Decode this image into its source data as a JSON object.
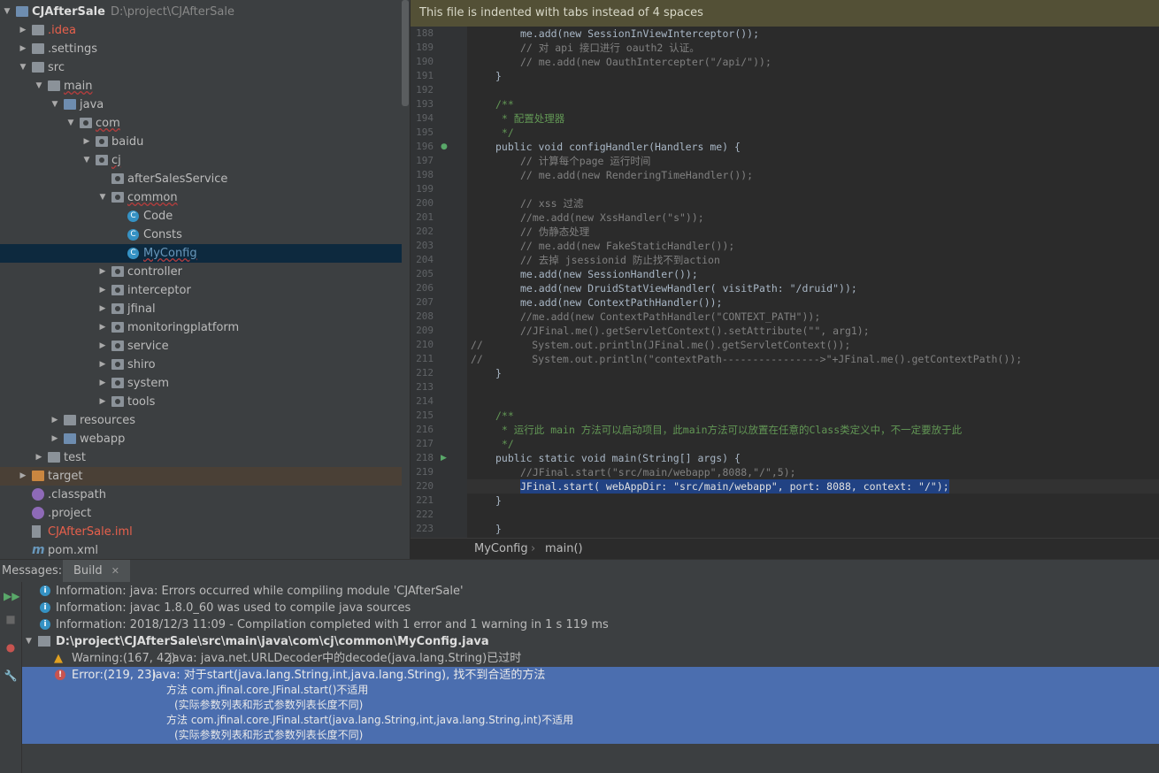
{
  "project": {
    "name": "CJAfterSale",
    "path": "D:\\project\\CJAfterSale",
    "tree": [
      {
        "label": "CJAfterSale",
        "indent": 0,
        "arrow": "open",
        "icon": "project-icon"
      },
      {
        "label": ".idea",
        "indent": 1,
        "arrow": "closed",
        "icon": "folder-icon",
        "style": "red"
      },
      {
        "label": ".settings",
        "indent": 1,
        "arrow": "closed",
        "icon": "folder-icon"
      },
      {
        "label": "src",
        "indent": 1,
        "arrow": "open",
        "icon": "folder-icon"
      },
      {
        "label": "main",
        "indent": 2,
        "arrow": "open",
        "icon": "folder-icon",
        "style": "wavy"
      },
      {
        "label": "java",
        "indent": 3,
        "arrow": "open",
        "icon": "source-folder-icon"
      },
      {
        "label": "com",
        "indent": 4,
        "arrow": "open",
        "icon": "package-icon",
        "style": "wavy"
      },
      {
        "label": "baidu",
        "indent": 5,
        "arrow": "closed",
        "icon": "package-icon"
      },
      {
        "label": "cj",
        "indent": 5,
        "arrow": "open",
        "icon": "package-icon",
        "style": "wavy"
      },
      {
        "label": "afterSalesService",
        "indent": 6,
        "arrow": "none",
        "icon": "package-icon"
      },
      {
        "label": "common",
        "indent": 6,
        "arrow": "open",
        "icon": "package-icon",
        "style": "wavy"
      },
      {
        "label": "Code",
        "indent": 7,
        "arrow": "none",
        "icon": "class-icon"
      },
      {
        "label": "Consts",
        "indent": 7,
        "arrow": "none",
        "icon": "class-icon"
      },
      {
        "label": "MyConfig",
        "indent": 7,
        "arrow": "none",
        "icon": "class-icon",
        "style": "blue-wavy",
        "selected": true
      },
      {
        "label": "controller",
        "indent": 6,
        "arrow": "closed",
        "icon": "package-icon"
      },
      {
        "label": "interceptor",
        "indent": 6,
        "arrow": "closed",
        "icon": "package-icon"
      },
      {
        "label": "jfinal",
        "indent": 6,
        "arrow": "closed",
        "icon": "package-icon"
      },
      {
        "label": "monitoringplatform",
        "indent": 6,
        "arrow": "closed",
        "icon": "package-icon"
      },
      {
        "label": "service",
        "indent": 6,
        "arrow": "closed",
        "icon": "package-icon"
      },
      {
        "label": "shiro",
        "indent": 6,
        "arrow": "closed",
        "icon": "package-icon"
      },
      {
        "label": "system",
        "indent": 6,
        "arrow": "closed",
        "icon": "package-icon"
      },
      {
        "label": "tools",
        "indent": 6,
        "arrow": "closed",
        "icon": "package-icon"
      },
      {
        "label": "resources",
        "indent": 3,
        "arrow": "closed",
        "icon": "resources-folder-icon"
      },
      {
        "label": "webapp",
        "indent": 3,
        "arrow": "closed",
        "icon": "web-folder-icon"
      },
      {
        "label": "test",
        "indent": 2,
        "arrow": "closed",
        "icon": "folder-icon"
      },
      {
        "label": "target",
        "indent": 1,
        "arrow": "closed",
        "icon": "excluded-folder-icon",
        "highlight": true
      },
      {
        "label": ".classpath",
        "indent": 1,
        "arrow": "none",
        "icon": "file-icon"
      },
      {
        "label": ".project",
        "indent": 1,
        "arrow": "none",
        "icon": "file-icon"
      },
      {
        "label": "CJAfterSale.iml",
        "indent": 1,
        "arrow": "none",
        "icon": "iml-file-icon",
        "style": "red"
      },
      {
        "label": "pom.xml",
        "indent": 1,
        "arrow": "none",
        "icon": "maven-icon"
      }
    ]
  },
  "editor": {
    "banner": "This file is indented with tabs instead of 4 spaces",
    "lines": [
      {
        "n": "188",
        "t": "\tme.add(new SessionInViewInterceptor());",
        "k": "code"
      },
      {
        "n": "189",
        "t": "\t// 对 api 接口进行 oauth2 认证。",
        "k": "cmt"
      },
      {
        "n": "190",
        "t": "\t// me.add(new OauthIntercepter(\"/api/\"));",
        "k": "cmt"
      },
      {
        "n": "191",
        "t": "}",
        "k": "code"
      },
      {
        "n": "192",
        "t": "",
        "k": "code"
      },
      {
        "n": "193",
        "t": "/**",
        "k": "doc"
      },
      {
        "n": "194",
        "t": " * 配置处理器",
        "k": "doc"
      },
      {
        "n": "195",
        "t": " */",
        "k": "doc"
      },
      {
        "n": "196",
        "t": "public void configHandler(Handlers me) {",
        "k": "code"
      },
      {
        "n": "197",
        "t": "\t// 计算每个page 运行时间",
        "k": "cmt"
      },
      {
        "n": "198",
        "t": "\t// me.add(new RenderingTimeHandler());",
        "k": "cmt"
      },
      {
        "n": "199",
        "t": "",
        "k": "code"
      },
      {
        "n": "200",
        "t": "\t// xss 过滤",
        "k": "cmt"
      },
      {
        "n": "201",
        "t": "\t//me.add(new XssHandler(\"s\"));",
        "k": "cmt"
      },
      {
        "n": "202",
        "t": "\t// 伪静态处理",
        "k": "cmt"
      },
      {
        "n": "203",
        "t": "\t// me.add(new FakeStaticHandler());",
        "k": "cmt"
      },
      {
        "n": "204",
        "t": "\t// 去掉 jsessionid 防止找不到action",
        "k": "cmt"
      },
      {
        "n": "205",
        "t": "\tme.add(new SessionHandler());",
        "k": "code"
      },
      {
        "n": "206",
        "t": "\tme.add(new DruidStatViewHandler( visitPath: \"/druid\"));",
        "k": "code"
      },
      {
        "n": "207",
        "t": "\tme.add(new ContextPathHandler());",
        "k": "code"
      },
      {
        "n": "208",
        "t": "\t//me.add(new ContextPathHandler(\"CONTEXT_PATH\"));",
        "k": "cmt"
      },
      {
        "n": "209",
        "t": "\t//JFinal.me().getServletContext().setAttribute(\"\", arg1);",
        "k": "cmt"
      },
      {
        "n": "210",
        "t": "//\t\tSystem.out.println(JFinal.me().getServletContext());",
        "k": "cmt"
      },
      {
        "n": "211",
        "t": "//\t\tSystem.out.println(\"contextPath---------------->\"+JFinal.me().getContextPath());",
        "k": "cmt"
      },
      {
        "n": "212",
        "t": "}",
        "k": "code"
      },
      {
        "n": "213",
        "t": "",
        "k": "code"
      },
      {
        "n": "214",
        "t": "",
        "k": "code"
      },
      {
        "n": "215",
        "t": "/**",
        "k": "doc"
      },
      {
        "n": "216",
        "t": " * 运行此 main 方法可以启动项目，此main方法可以放置在任意的Class类定义中，不一定要放于此",
        "k": "doc"
      },
      {
        "n": "217",
        "t": " */",
        "k": "doc"
      },
      {
        "n": "218",
        "t": "public static void main(String[] args) {",
        "k": "code"
      },
      {
        "n": "219",
        "t": "\t//JFinal.start(\"src/main/webapp\",8088,\"/\",5);",
        "k": "cmt"
      },
      {
        "n": "220",
        "t": "\tJFinal.start( webAppDir: \"src/main/webapp\", port: 8088, context: \"/\");",
        "k": "sel"
      },
      {
        "n": "221",
        "t": "}",
        "k": "code"
      },
      {
        "n": "222",
        "t": "",
        "k": "code"
      },
      {
        "n": "223",
        "t": "}",
        "k": "code"
      }
    ],
    "breadcrumb": {
      "class": "MyConfig",
      "method": "main()"
    }
  },
  "messages": {
    "label": "Messages:",
    "tab": "Build",
    "items": [
      {
        "type": "info",
        "text": "Information: java: Errors occurred while compiling module 'CJAfterSale'"
      },
      {
        "type": "info",
        "text": "Information: javac 1.8.0_60 was used to compile java sources"
      },
      {
        "type": "info",
        "text": "Information: 2018/12/3 11:09 - Compilation completed with 1 error and 1 warning in 1 s 119 ms"
      }
    ],
    "file": "D:\\project\\CJAfterSale\\src\\main\\java\\com\\cj\\common\\MyConfig.java",
    "warning": {
      "loc": "Warning:(167, 42)",
      "text": "java: java.net.URLDecoder中的decode(java.lang.String)已过时"
    },
    "error": {
      "loc": "Error:(219, 23)",
      "text": "java: 对于start(java.lang.String,int,java.lang.String), 找不到合适的方法",
      "details": [
        "方法 com.jfinal.core.JFinal.start()不适用",
        "(实际参数列表和形式参数列表长度不同)",
        "方法 com.jfinal.core.JFinal.start(java.lang.String,int,java.lang.String,int)不适用",
        "(实际参数列表和形式参数列表长度不同)"
      ]
    }
  }
}
